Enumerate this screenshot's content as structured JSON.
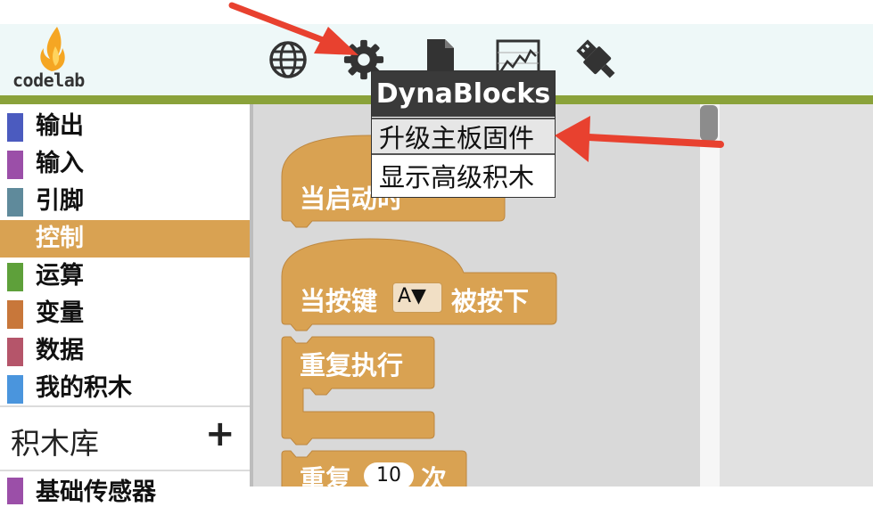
{
  "app": {
    "logo_text": "codelab",
    "flame_color": "#f5a623"
  },
  "toolbar": {
    "icons": [
      "globe-icon",
      "gear-icon",
      "document-icon",
      "chart-icon",
      "usb-icon"
    ]
  },
  "categories": [
    {
      "label": "输出",
      "color": "#4b5bbf"
    },
    {
      "label": "输入",
      "color": "#9b4fa8"
    },
    {
      "label": "引脚",
      "color": "#5f8a9b"
    },
    {
      "label": "控制",
      "color": "#d9a252",
      "active": true
    },
    {
      "label": "运算",
      "color": "#5ea03a"
    },
    {
      "label": "变量",
      "color": "#c8773a"
    },
    {
      "label": "数据",
      "color": "#b5556a"
    },
    {
      "label": "我的积木",
      "color": "#4a95dd"
    }
  ],
  "library": {
    "label": "积木库",
    "add_label": "+"
  },
  "sub_category": {
    "label": "基础传感器"
  },
  "blocks": {
    "when_start": "当启动时",
    "when_key_pressed_prefix": "当按键",
    "key_value": "A▼",
    "when_key_pressed_suffix": "被按下",
    "repeat_forever": "重复执行",
    "repeat_prefix": "重复",
    "repeat_count": "10",
    "repeat_suffix": "次"
  },
  "settings_menu": {
    "title": "DynaBlocks",
    "items": [
      "升级主板固件",
      "显示高级积木"
    ]
  },
  "colors": {
    "block": "#d9a252",
    "header_bg": "#eef8f8",
    "accent_bar": "#8aa23a",
    "annotation_arrow": "#e8412f"
  }
}
